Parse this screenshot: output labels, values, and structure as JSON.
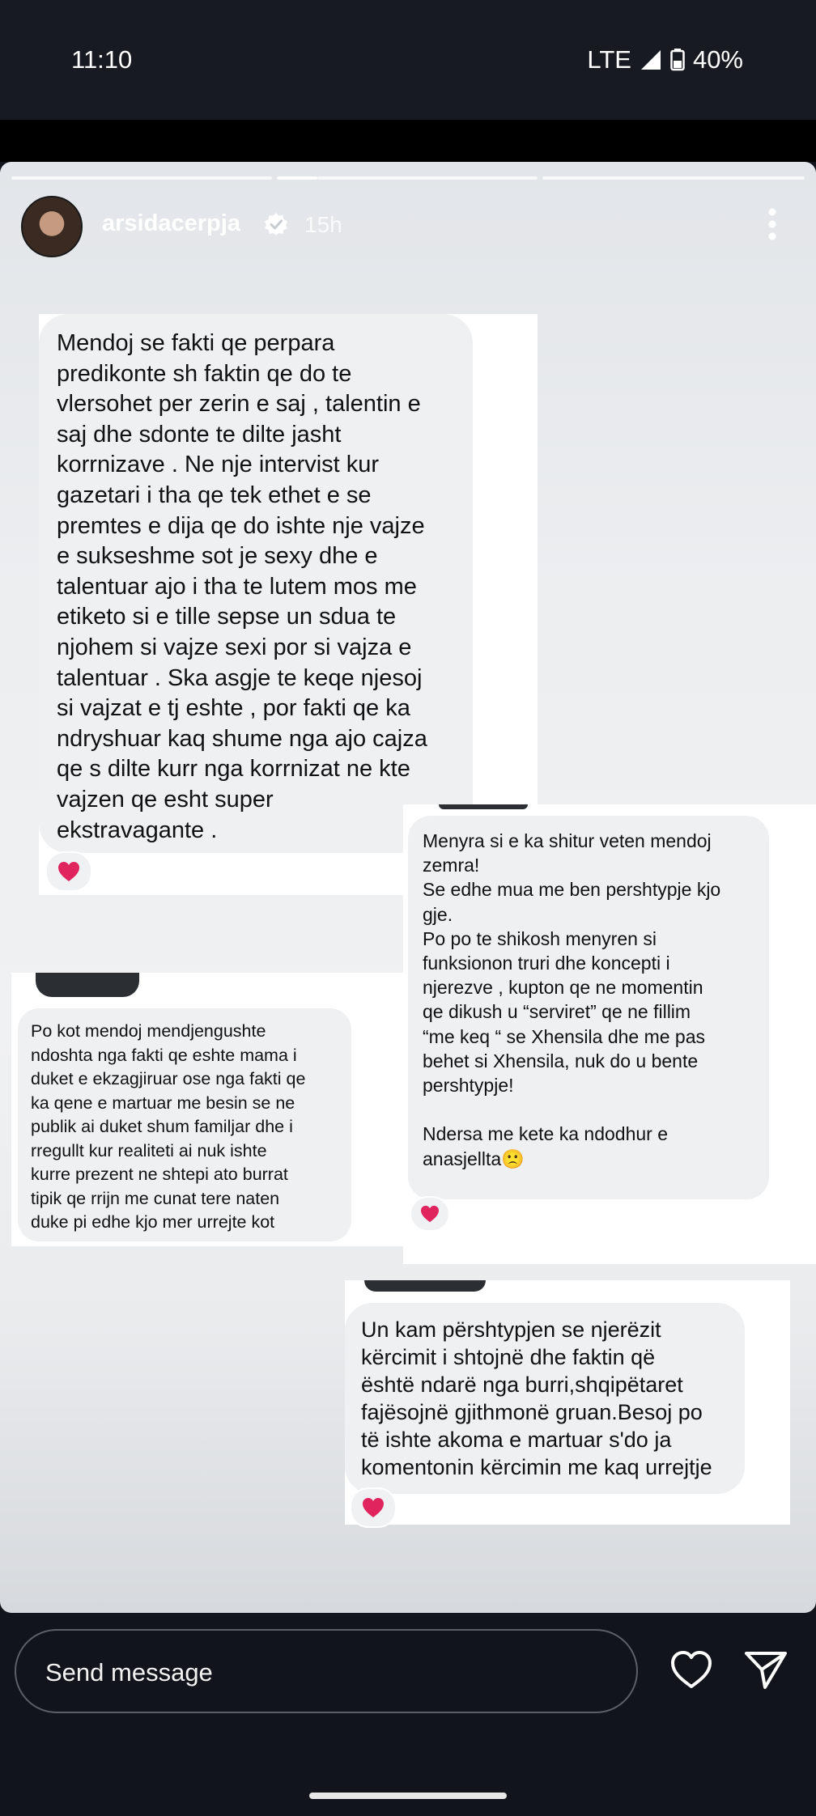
{
  "status_bar": {
    "time": "11:10",
    "network": "LTE",
    "battery": "40%"
  },
  "story": {
    "username": "arsidacerpja",
    "time_ago": "15h",
    "progress_segments": 3,
    "active_segment": 2
  },
  "messages": {
    "m1": "Mendoj se fakti qe perpara\npredikonte sh faktin qe do te\nvlersohet per zerin e saj , talentin e\nsaj dhe sdonte te dilte jasht\nkorrnizave . Ne nje intervist kur\ngazetari i tha qe tek ethet e se\npremtes e dija qe do ishte nje vajze\ne sukseshme sot je sexy dhe e\ntalentuar ajo i tha te lutem mos me\netiketo si e tille sepse un sdua te\nnjohem si vajze sexi por si vajza e\ntalentuar . Ska asgje te keqe njesoj\nsi vajzat e tj eshte , por fakti qe ka\nndryshuar kaq shume nga ajo cajza\nqe s dilte kurr nga korrnizat ne kte\nvajzen qe esht super\nekstravagante .",
    "m2": "Menyra si e ka shitur veten mendoj\nzemra!\nSe edhe mua me ben pershtypje kjo\ngje.\nPo po te shikosh menyren si\nfunksionon truri dhe koncepti i\nnjerezve , kupton qe ne momentin\nqe dikush u “serviret” qe ne fillim\n“me keq “ se Xhensila dhe me pas\nbehet si Xhensila, nuk do u bente\npershtypje!\n\nNdersa me kete ka ndodhur e\nanasjellta🙁",
    "m3": "Po kot mendoj mendjengushte\nndoshta nga fakti qe eshte mama i\nduket e ekzagjiruar ose nga fakti qe\nka qene e martuar me besin se ne\npublik ai duket shum familjar dhe i\nrregullt kur realiteti ai nuk ishte\nkurre prezent ne shtepi ato burrat\ntipik qe rrijn me cunat tere naten\nduke pi edhe kjo mer urrejte kot",
    "m4": "Un kam përshtypjen se njerëzit\nkërcimit i shtojnë dhe faktin që\nështë ndarë nga burri,shqipëtaret\nfajësojnë gjithmonë gruan.Besoj po\ntë ishte akoma e martuar s'do ja\nkomentonin kërcimin me kaq urrejtje"
  },
  "reactions": {
    "emoji": "heart",
    "color": "#e0245e"
  },
  "composer": {
    "placeholder": "Send message"
  },
  "colors": {
    "background": "#11141a",
    "bubble": "#eff0f2",
    "text": "#111111"
  }
}
